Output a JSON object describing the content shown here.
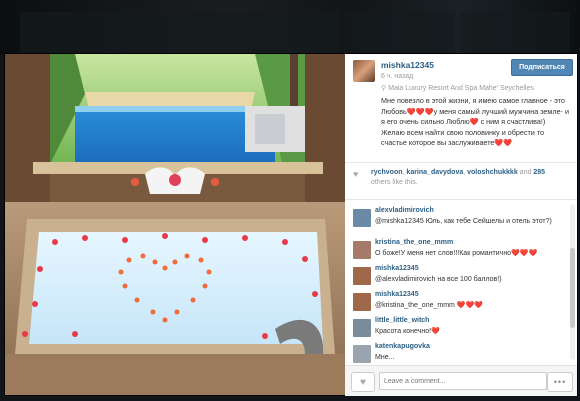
{
  "post": {
    "username": "mishka12345",
    "time": "6 ч. назад",
    "follow_label": "Подписаться",
    "location": "Maia Luxury Resort And Spa Mahe' Seychelles",
    "caption": "Мне повезло в этой жизни, я имею самое главное - это Любовь❤️❤️❤️у меня самый лучший мужчина земле- и я его очень сильно Люблю❤️ с ним я счастлива!) Желаю всем найти свою половинку и обрести то счастье которое вы заслуживаете❤️❤️"
  },
  "likes": {
    "names": [
      "rychvoon",
      "karina_davydova",
      "voloshchukkkk"
    ],
    "separators": [
      ",",
      ","
    ],
    "and_text": "and",
    "count_text": "285",
    "suffix": "others like this."
  },
  "comments": [
    {
      "user": "alexvladimirovich",
      "text": "@mishka12345 Юль, как тебе Сейшелы и отель этот?)",
      "color": "#6b8aa6"
    },
    {
      "user": "kristina_the_one_mmm",
      "text": "О боже!У меня нет слов!!!Как романтично❤️❤️❤️",
      "color": "#a57a6a"
    },
    {
      "user": "mishka12345",
      "text": "@alexvladimirovich на все 100 баллов!)",
      "color": "#a0684a"
    },
    {
      "user": "mishka12345",
      "text": "@kristina_the_one_mmm ❤️❤️❤️",
      "color": "#a0684a"
    },
    {
      "user": "little_little_witch",
      "text": "Красота конечно!❤️",
      "color": "#7a8c9a"
    },
    {
      "user": "katenkapugovka",
      "text": "Мне...",
      "color": "#9aa4ae"
    }
  ],
  "comment_input": {
    "placeholder": "Leave a comment..."
  },
  "icons": {
    "like": "heart-icon",
    "more": "more-options-icon",
    "location": "location-pin-icon"
  }
}
